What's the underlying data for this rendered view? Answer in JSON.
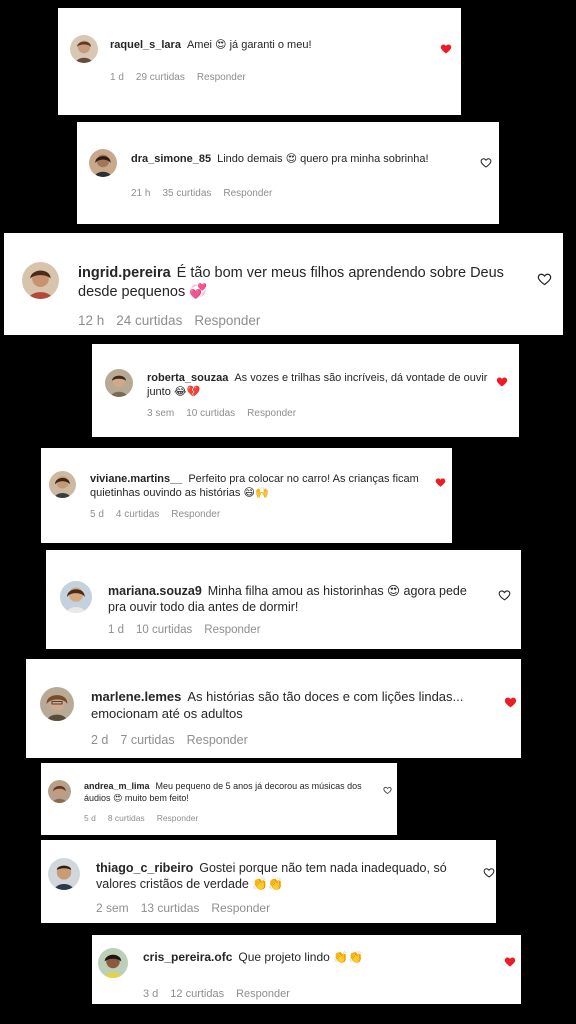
{
  "comments": [
    {
      "user": "raquel_s_lara",
      "text": "Amei 😍 já garanti o meu!",
      "time": "1 d",
      "likes": "29 curtidas",
      "reply": "Responder",
      "liked": true
    },
    {
      "user": "dra_simone_85",
      "text": "Lindo demais 😍 quero pra minha sobrinha!",
      "time": "21 h",
      "likes": "35 curtidas",
      "reply": "Responder",
      "liked": false
    },
    {
      "user": "ingrid.pereira",
      "text": "É tão bom ver meus filhos aprendendo sobre Deus desde pequenos 💞",
      "time": "12 h",
      "likes": "24 curtidas",
      "reply": "Responder",
      "liked": false
    },
    {
      "user": "roberta_souzaa",
      "text": "As vozes e trilhas são incríveis, dá vontade de ouvir junto 😂💔",
      "time": "3 sem",
      "likes": "10 curtidas",
      "reply": "Responder",
      "liked": true
    },
    {
      "user": "viviane.martins__",
      "text": "Perfeito pra colocar no carro! As crianças ficam quietinhas ouvindo as histórias 😄🙌",
      "time": "5 d",
      "likes": "4 curtidas",
      "reply": "Responder",
      "liked": true
    },
    {
      "user": "mariana.souza9",
      "text": "Minha filha amou as historinhas 😍 agora pede pra ouvir todo dia antes de dormir!",
      "time": "1 d",
      "likes": "10 curtidas",
      "reply": "Responder",
      "liked": false
    },
    {
      "user": "marlene.lemes",
      "text": "As histórias são tão doces e com lições lindas... emocionam até os adultos",
      "time": "2 d",
      "likes": "7 curtidas",
      "reply": "Responder",
      "liked": true
    },
    {
      "user": "andrea_m_lima",
      "text": "Meu pequeno de 5 anos já decorou as músicas dos áudios 😍 muito bem feito!",
      "time": "5 d",
      "likes": "8 curtidas",
      "reply": "Responder",
      "liked": false
    },
    {
      "user": "thiago_c_ribeiro",
      "text": "Gostei porque não tem nada inadequado, só valores cristãos de verdade 👏👏",
      "time": "2 sem",
      "likes": "13 curtidas",
      "reply": "Responder",
      "liked": false
    },
    {
      "user": "cris_pereira.ofc",
      "text": "Que projeto lindo 👏👏",
      "time": "3 d",
      "likes": "12 curtidas",
      "reply": "Responder",
      "liked": true
    }
  ],
  "colors": {
    "heart_liked": "#ed1c24",
    "heart_outline": "#262626",
    "meta": "#8e8e8e",
    "background": "#000000"
  }
}
